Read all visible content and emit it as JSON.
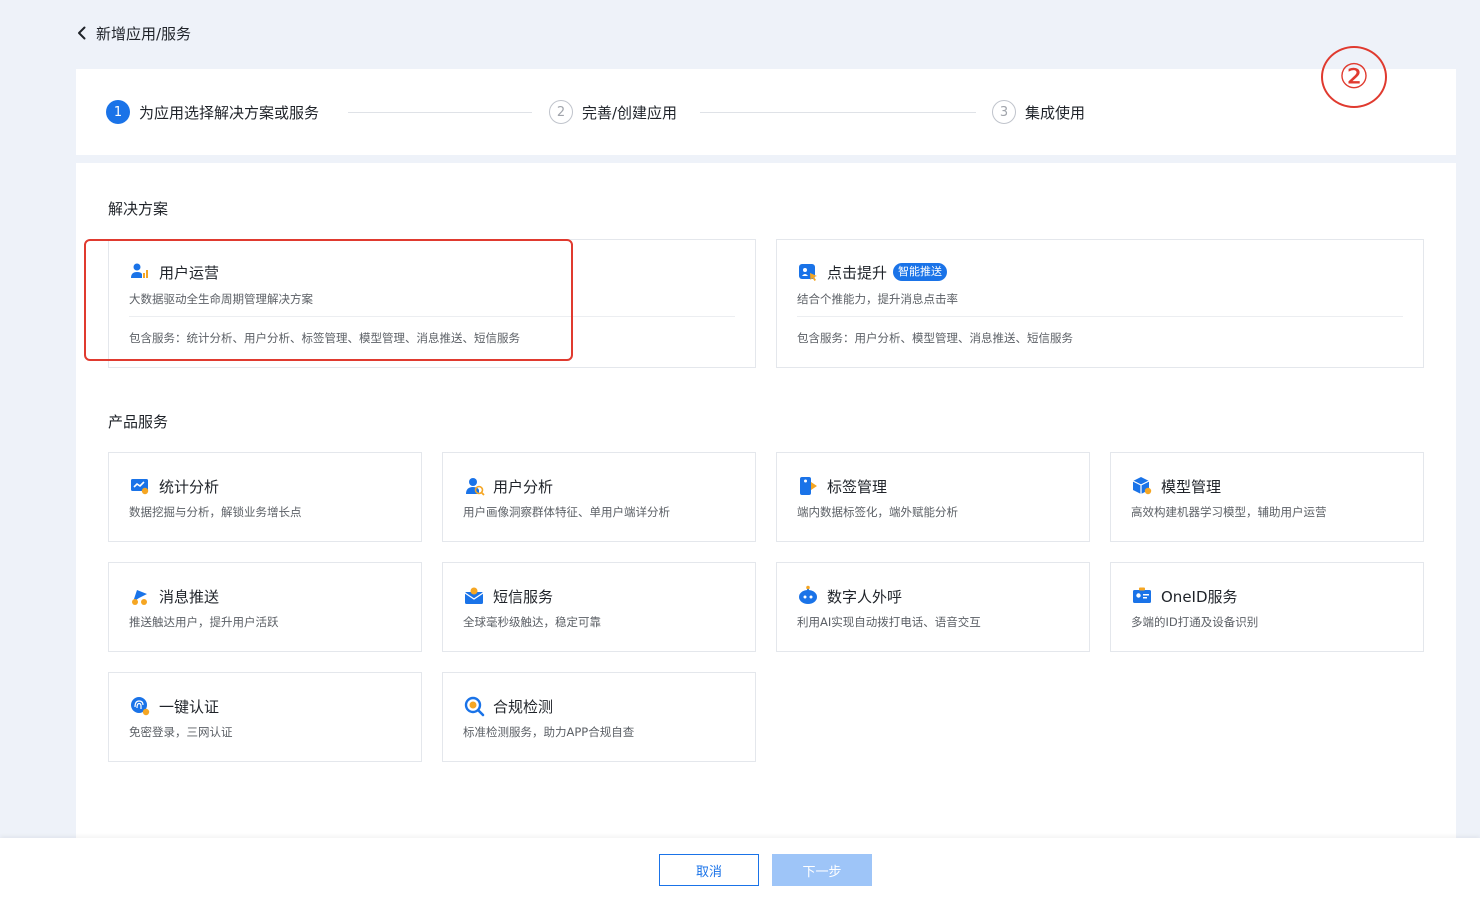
{
  "header": {
    "back_icon": "chevron-left-icon",
    "title": "新增应用/服务"
  },
  "steps": [
    {
      "num": "1",
      "label": "为应用选择解决方案或服务",
      "state": "active"
    },
    {
      "num": "2",
      "label": "完善/创建应用",
      "state": "idle"
    },
    {
      "num": "3",
      "label": "集成使用",
      "state": "idle"
    }
  ],
  "annotation": {
    "marker": "②"
  },
  "solutions": {
    "title": "解决方案",
    "items": [
      {
        "icon": "user-operation-icon",
        "name": "用户运营",
        "badge": "",
        "desc": "大数据驱动全生命周期管理解决方案",
        "services": "包含服务：统计分析、用户分析、标签管理、模型管理、消息推送、短信服务"
      },
      {
        "icon": "click-boost-icon",
        "name": "点击提升",
        "badge": "智能推送",
        "desc": "结合个推能力，提升消息点击率",
        "services": "包含服务：用户分析、模型管理、消息推送、短信服务"
      }
    ]
  },
  "products": {
    "title": "产品服务",
    "items": [
      {
        "icon": "statistics-icon",
        "name": "统计分析",
        "desc": "数据挖掘与分析，解锁业务增长点"
      },
      {
        "icon": "user-analysis-icon",
        "name": "用户分析",
        "desc": "用户画像洞察群体特征、单用户端详分析"
      },
      {
        "icon": "tag-icon",
        "name": "标签管理",
        "desc": "端内数据标签化，端外赋能分析"
      },
      {
        "icon": "model-cube-icon",
        "name": "模型管理",
        "desc": "高效构建机器学习模型，辅助用户运营"
      },
      {
        "icon": "push-icon",
        "name": "消息推送",
        "desc": "推送触达用户，提升用户活跃"
      },
      {
        "icon": "sms-icon",
        "name": "短信服务",
        "desc": "全球毫秒级触达，稳定可靠"
      },
      {
        "icon": "robot-call-icon",
        "name": "数字人外呼",
        "desc": "利用AI实现自动拨打电话、语音交互"
      },
      {
        "icon": "id-card-icon",
        "name": "OneID服务",
        "desc": "多端的ID打通及设备识别"
      },
      {
        "icon": "fingerprint-icon",
        "name": "一键认证",
        "desc": "免密登录，三网认证"
      },
      {
        "icon": "compliance-check-icon",
        "name": "合规检测",
        "desc": "标准检测服务，助力APP合规自查"
      }
    ]
  },
  "footer": {
    "cancel_label": "取消",
    "next_label": "下一步"
  },
  "colors": {
    "primary": "#1a73e8",
    "annotation": "#e03a2f",
    "disabled": "#9ec5f8"
  }
}
